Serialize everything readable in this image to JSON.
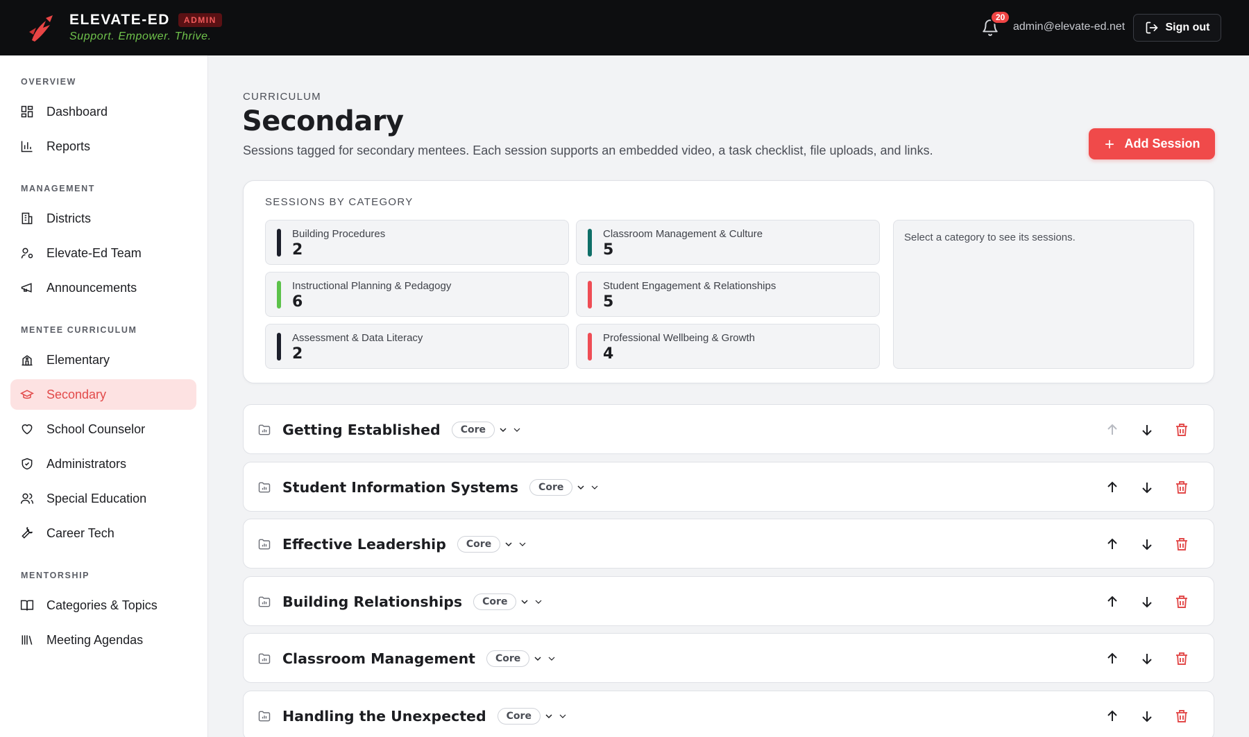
{
  "header": {
    "brand": "ELEVATE-ED",
    "badge": "ADMIN",
    "tagline": "Support. Empower. Thrive.",
    "notification_count": "20",
    "email": "admin@elevate-ed.net",
    "signout_label": "Sign out"
  },
  "sidebar": {
    "sections": [
      {
        "label": "OVERVIEW",
        "items": [
          {
            "label": "Dashboard",
            "icon": "dashboard-icon"
          },
          {
            "label": "Reports",
            "icon": "bar-chart-icon"
          }
        ]
      },
      {
        "label": "MANAGEMENT",
        "items": [
          {
            "label": "Districts",
            "icon": "building-icon"
          },
          {
            "label": "Elevate-Ed Team",
            "icon": "user-cog-icon"
          },
          {
            "label": "Announcements",
            "icon": "megaphone-icon"
          }
        ]
      },
      {
        "label": "MENTEE CURRICULUM",
        "items": [
          {
            "label": "Elementary",
            "icon": "school-icon"
          },
          {
            "label": "Secondary",
            "icon": "graduation-cap-icon",
            "active": true
          },
          {
            "label": "School Counselor",
            "icon": "heart-icon"
          },
          {
            "label": "Administrators",
            "icon": "shield-check-icon"
          },
          {
            "label": "Special Education",
            "icon": "users-icon"
          },
          {
            "label": "Career Tech",
            "icon": "wrench-icon"
          }
        ]
      },
      {
        "label": "MENTORSHIP",
        "items": [
          {
            "label": "Categories & Topics",
            "icon": "book-open-icon"
          },
          {
            "label": "Meeting Agendas",
            "icon": "library-icon"
          }
        ]
      }
    ]
  },
  "main": {
    "eyebrow": "CURRICULUM",
    "title": "Secondary",
    "description": "Sessions tagged for secondary mentees. Each session supports an embedded video, a task checklist, file uploads, and links.",
    "add_label": "Add Session"
  },
  "categories": {
    "title": "SESSIONS BY CATEGORY",
    "hint": "Select a category to see its sessions.",
    "items": [
      {
        "name": "Building Procedures",
        "count": "2",
        "color": "#1c1f2b"
      },
      {
        "name": "Classroom Management & Culture",
        "count": "5",
        "color": "#0f6f68"
      },
      {
        "name": "Instructional Planning & Pedagogy",
        "count": "6",
        "color": "#5cc24a"
      },
      {
        "name": "Student Engagement & Relationships",
        "count": "5",
        "color": "#ef4d55"
      },
      {
        "name": "Assessment & Data Literacy",
        "count": "2",
        "color": "#1c1f2b"
      },
      {
        "name": "Professional Wellbeing & Growth",
        "count": "4",
        "color": "#ef4d55"
      }
    ]
  },
  "sessions": [
    {
      "title": "Getting Established",
      "tag": "Core",
      "up_disabled": true
    },
    {
      "title": "Student Information Systems",
      "tag": "Core"
    },
    {
      "title": "Effective Leadership",
      "tag": "Core"
    },
    {
      "title": "Building Relationships",
      "tag": "Core"
    },
    {
      "title": "Classroom Management",
      "tag": "Core"
    },
    {
      "title": "Handling the Unexpected",
      "tag": "Core"
    }
  ],
  "colors": {
    "accent": "#f04a4a",
    "active_bg": "#fde2e2",
    "topbar": "#0d0e10",
    "tagline": "#6fc24b"
  }
}
